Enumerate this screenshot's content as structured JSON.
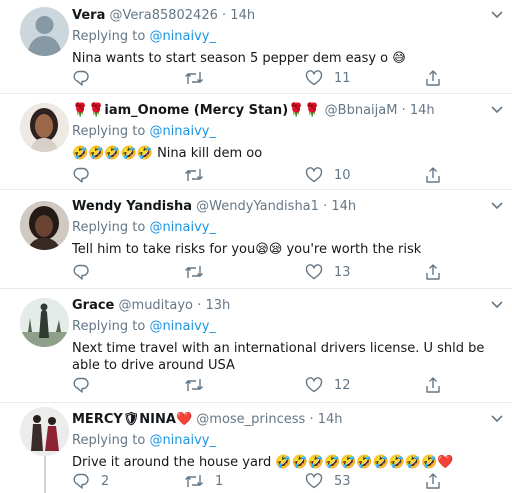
{
  "replying_label": "Replying to",
  "mention": "@ninaivy_",
  "tweets": [
    {
      "name": "Vera",
      "handle": "@Vera85802426",
      "sep": "·",
      "time": "14h",
      "text": "Nina wants to start season 5 pepper dem easy o 😅",
      "replies": "",
      "retweets": "",
      "likes": "11"
    },
    {
      "name": "🌹🌹iam_Onome (Mercy Stan)🌹🌹",
      "handle": "@BbnaijaM",
      "sep": "·",
      "time": "14h",
      "text": "🤣🤣🤣🤣🤣 Nina kill dem oo",
      "replies": "",
      "retweets": "",
      "likes": "10"
    },
    {
      "name": "Wendy Yandisha",
      "handle": "@WendyYandisha1",
      "sep": "·",
      "time": "14h",
      "text": "Tell him to take risks for you😪😪 you're worth the risk",
      "replies": "",
      "retweets": "",
      "likes": "13"
    },
    {
      "name": "Grace",
      "handle": "@muditayo",
      "sep": "·",
      "time": "13h",
      "text": "Next time travel with an international drivers license. U shld be able to drive around USA",
      "replies": "",
      "retweets": "",
      "likes": "12"
    },
    {
      "name": "MERCY🛡NINA❤️",
      "handle": "@mose_princess",
      "sep": "·",
      "time": "14h",
      "text": "Drive it around the house yard 🤣🤣🤣🤣🤣🤣🤣🤣🤣🤣❤️",
      "replies": "2",
      "retweets": "1",
      "likes": "53"
    }
  ]
}
